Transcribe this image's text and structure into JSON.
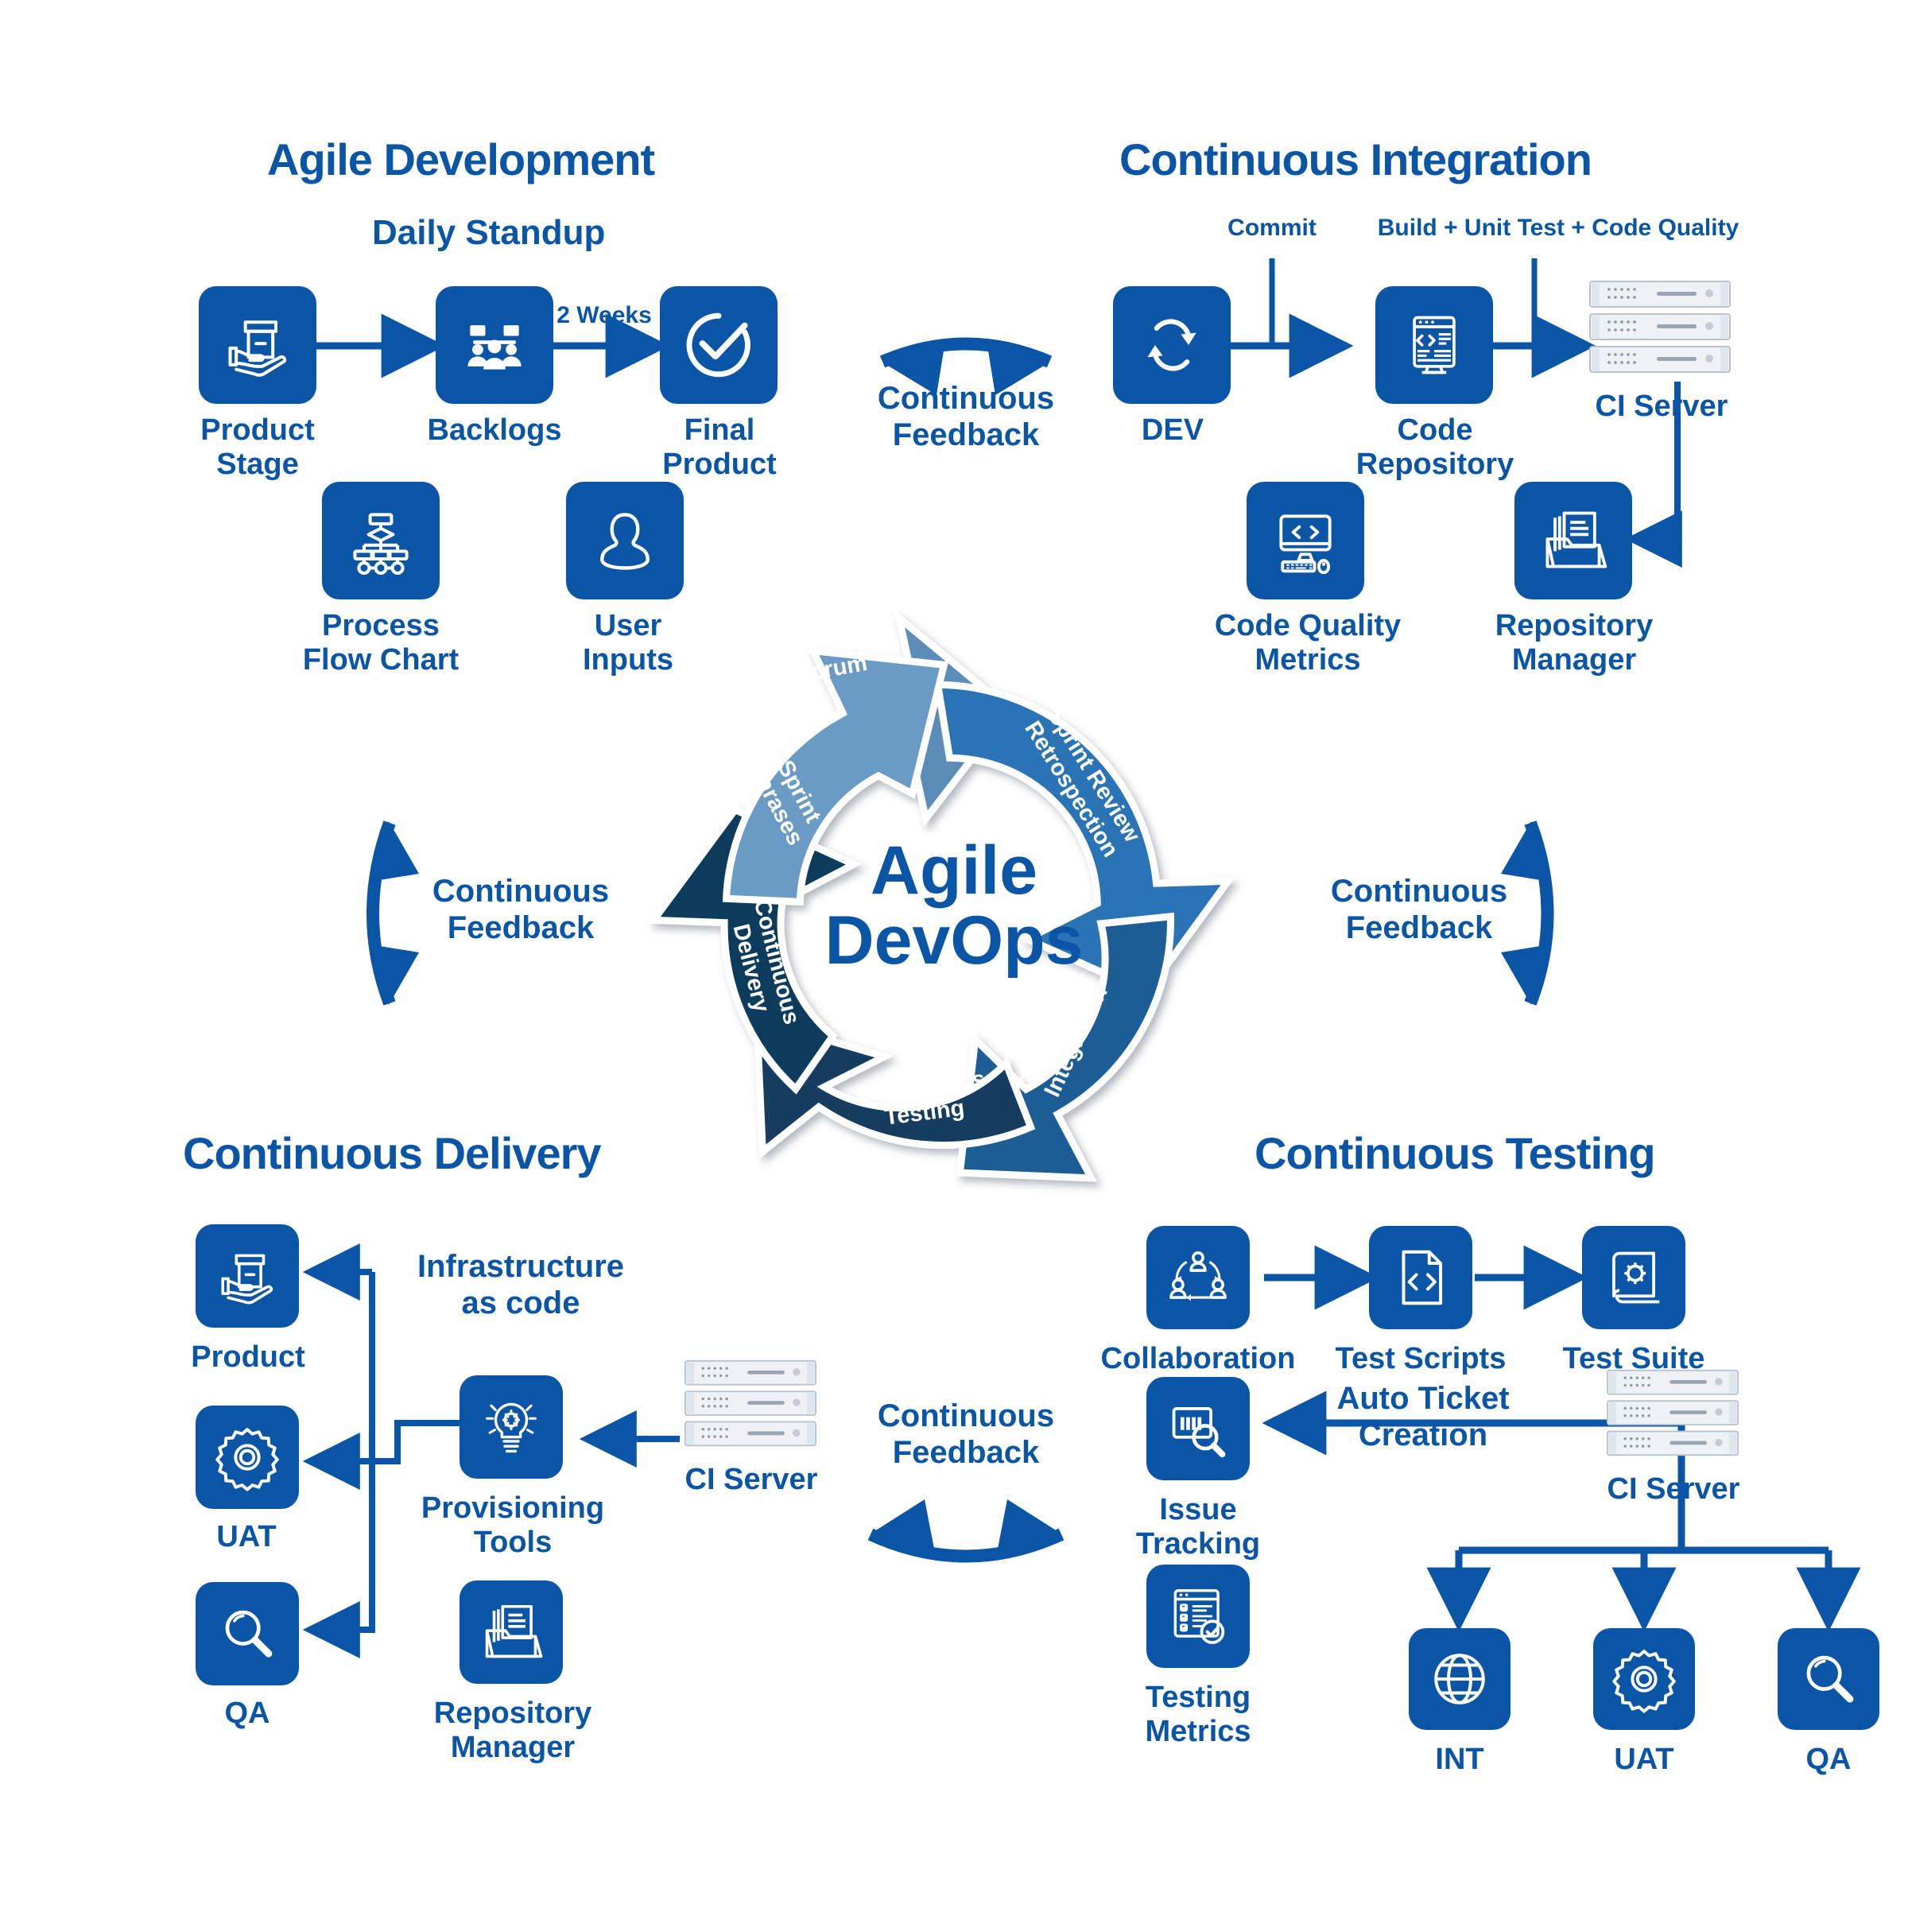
{
  "center": {
    "line1": "Agile",
    "line2": "DevOps"
  },
  "wheel": {
    "segments": [
      {
        "name": "daily-scrum",
        "label": "Daily\nScrum",
        "color": "#5b8cb8"
      },
      {
        "name": "sprint-review",
        "label": "Sprint Review\nRetrospection",
        "color": "#2b73b5"
      },
      {
        "name": "continuous-integration",
        "label": "Continuous\nIntegration",
        "color": "#1c5d96"
      },
      {
        "name": "continuous-testing",
        "label": "Continuous\nTesting",
        "color": "#143c5e"
      },
      {
        "name": "continuous-delivery",
        "label": "Continuous\nDelivery",
        "color": "#103a5c"
      },
      {
        "name": "sprint-phrases",
        "label": "Sprint\nPhrases",
        "color": "#6b9bc4"
      }
    ]
  },
  "colors": {
    "brand": "#0b55a6",
    "tile": "#0b55a6",
    "arrow": "#0b55a6",
    "server_body": "#eef1f5",
    "server_edge": "#b8c3cf"
  },
  "agile_development": {
    "title": "Agile Development",
    "subtitle": "Daily Standup",
    "edge_2weeks": "2 Weeks",
    "nodes": [
      {
        "name": "product-stage",
        "label": "Product\nStage",
        "icon": "hand-box-icon"
      },
      {
        "name": "backlogs",
        "label": "Backlogs",
        "icon": "team-board-icon"
      },
      {
        "name": "final-product",
        "label": "Final\nProduct",
        "icon": "check-circle-icon"
      },
      {
        "name": "process-flow-chart",
        "label": "Process\nFlow Chart",
        "icon": "flowchart-icon"
      },
      {
        "name": "user-inputs",
        "label": "User\nInputs",
        "icon": "user-icon"
      }
    ]
  },
  "continuous_integration": {
    "title": "Continuous Integration",
    "edge_commit": "Commit",
    "edge_build": "Build + Unit Test + Code Quality",
    "nodes": [
      {
        "name": "dev",
        "label": "DEV",
        "icon": "sync-icon"
      },
      {
        "name": "code-repository",
        "label": "Code\nRepository",
        "icon": "code-monitor-icon"
      },
      {
        "name": "ci-server",
        "label": "CI Server",
        "icon": "server-rack-icon"
      },
      {
        "name": "code-quality-metrics",
        "label": "Code Quality\nMetrics",
        "icon": "code-screen-icon"
      },
      {
        "name": "repository-manager",
        "label": "Repository\nManager",
        "icon": "folder-docs-icon"
      }
    ]
  },
  "continuous_delivery": {
    "title": "Continuous Delivery",
    "edge_iac": "Infrastructure\nas code",
    "nodes": [
      {
        "name": "product",
        "label": "Product",
        "icon": "hand-box-icon"
      },
      {
        "name": "uat",
        "label": "UAT",
        "icon": "gear-icon"
      },
      {
        "name": "qa",
        "label": "QA",
        "icon": "magnifier-icon"
      },
      {
        "name": "provisioning-tools",
        "label": "Provisioning\nTools",
        "icon": "bulb-gear-icon"
      },
      {
        "name": "repository-manager",
        "label": "Repository\nManager",
        "icon": "folder-docs-icon"
      },
      {
        "name": "ci-server",
        "label": "CI Server",
        "icon": "server-rack-icon"
      }
    ]
  },
  "continuous_testing": {
    "title": "Continuous Testing",
    "edge_auto_ticket": "Auto Ticket\nCreation",
    "nodes": [
      {
        "name": "collaboration",
        "label": "Collaboration",
        "icon": "collaboration-icon"
      },
      {
        "name": "test-scripts",
        "label": "Test Scripts",
        "icon": "code-file-icon"
      },
      {
        "name": "test-suite",
        "label": "Test Suite",
        "icon": "scroll-gear-icon"
      },
      {
        "name": "issue-tracking",
        "label": "Issue\nTracking",
        "icon": "bug-search-icon"
      },
      {
        "name": "testing-metrics",
        "label": "Testing\nMetrics",
        "icon": "checklist-icon"
      },
      {
        "name": "ci-server",
        "label": "CI Server",
        "icon": "server-rack-icon"
      },
      {
        "name": "int",
        "label": "INT",
        "icon": "globe-icon"
      },
      {
        "name": "uat",
        "label": "UAT",
        "icon": "gear-icon"
      },
      {
        "name": "qa",
        "label": "QA",
        "icon": "magnifier-icon"
      }
    ]
  },
  "feedback": {
    "top": "Continuous\nFeedback",
    "left": "Continuous\nFeedback",
    "right": "Continuous\nFeedback",
    "bottom": "Continuous\nFeedback"
  }
}
